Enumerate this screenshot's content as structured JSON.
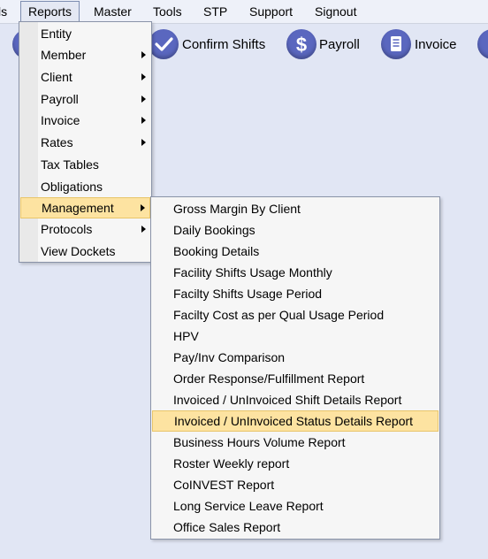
{
  "menubar": {
    "items": [
      "ls",
      "Reports",
      "Master",
      "Tools",
      "STP",
      "Support",
      "Signout"
    ]
  },
  "toolbar": {
    "confirm_shifts": "Confirm Shifts",
    "payroll": "Payroll",
    "invoice": "Invoice"
  },
  "reports_menu": {
    "items": [
      {
        "label": "Entity",
        "submenu": false
      },
      {
        "label": "Member",
        "submenu": true
      },
      {
        "label": "Client",
        "submenu": true
      },
      {
        "label": "Payroll",
        "submenu": true
      },
      {
        "label": "Invoice",
        "submenu": true
      },
      {
        "label": "Rates",
        "submenu": true
      },
      {
        "label": "Tax Tables",
        "submenu": false
      },
      {
        "label": "Obligations",
        "submenu": false
      },
      {
        "label": "Management",
        "submenu": true,
        "highlighted": true
      },
      {
        "label": "Protocols",
        "submenu": true
      },
      {
        "label": "View Dockets",
        "submenu": false
      }
    ]
  },
  "management_menu": {
    "items": [
      {
        "label": "Gross Margin By Client"
      },
      {
        "label": "Daily Bookings"
      },
      {
        "label": "Booking Details"
      },
      {
        "label": "Facility Shifts Usage Monthly"
      },
      {
        "label": "Facilty Shifts Usage Period"
      },
      {
        "label": "Facilty Cost as per Qual Usage Period"
      },
      {
        "label": "HPV"
      },
      {
        "label": "Pay/Inv Comparison"
      },
      {
        "label": "Order Response/Fulfillment Report"
      },
      {
        "label": "Invoiced / UnInvoiced Shift Details Report"
      },
      {
        "label": "Invoiced / UnInvoiced Status Details Report",
        "highlighted": true
      },
      {
        "label": "Business Hours Volume Report"
      },
      {
        "label": "Roster Weekly report"
      },
      {
        "label": "CoINVEST Report"
      },
      {
        "label": "Long Service Leave Report"
      },
      {
        "label": "Office Sales Report"
      }
    ]
  }
}
